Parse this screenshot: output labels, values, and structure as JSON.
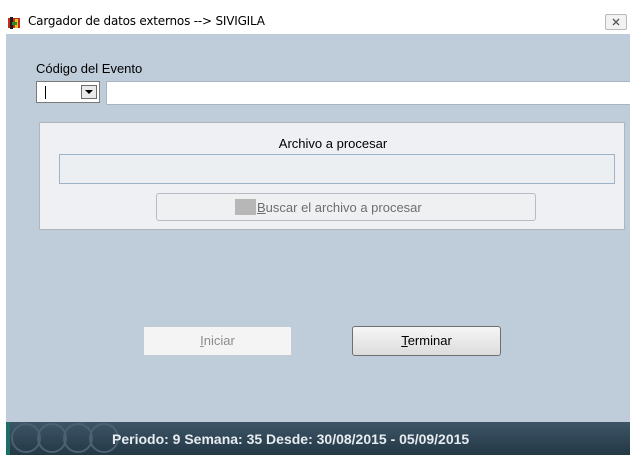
{
  "window": {
    "title": "Cargador de datos externos --> SIVIGILA"
  },
  "evento": {
    "label": "Código del Evento",
    "code_value": "",
    "description_value": ""
  },
  "archivo": {
    "title": "Archivo a procesar",
    "path_value": "",
    "browse_mnemonic": "B",
    "browse_rest": "uscar el archivo a procesar"
  },
  "actions": {
    "iniciar_mnemonic": "I",
    "iniciar_rest": "niciar",
    "terminar_mnemonic": "T",
    "terminar_rest": "erminar"
  },
  "statusbar": {
    "text": "Periodo: 9 Semana: 35 Desde: 30/08/2015 - 05/09/2015"
  },
  "colors": {
    "window_bg": "#bfcddb",
    "panel_bg": "#eef0f3",
    "status_bg": "#2d4454"
  }
}
